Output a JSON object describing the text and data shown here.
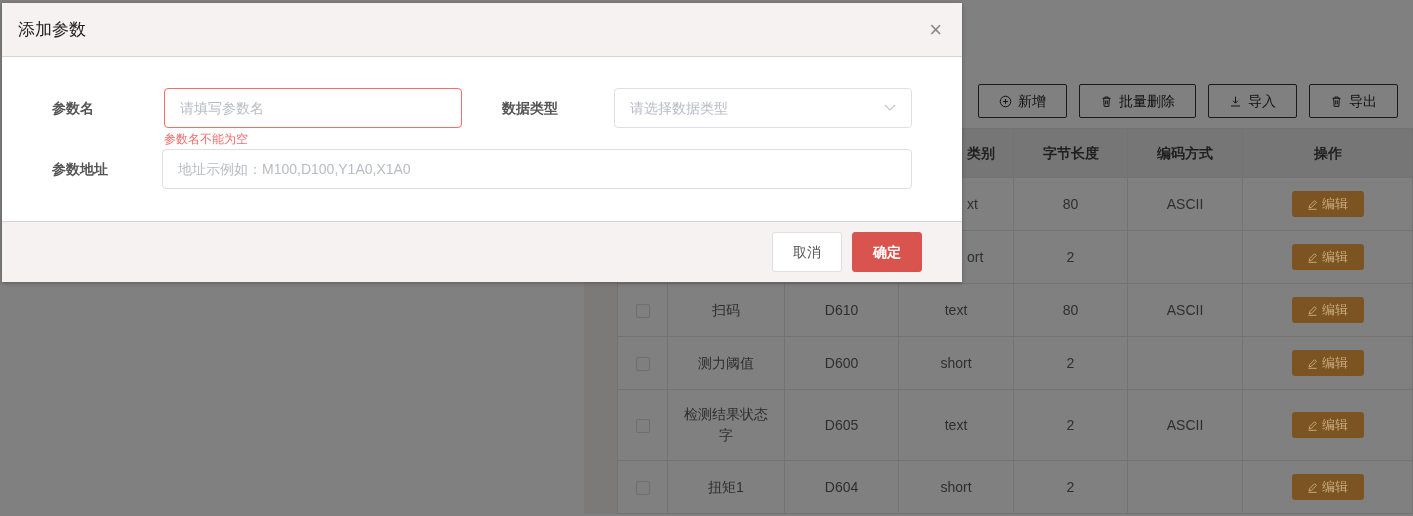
{
  "dialog": {
    "title": "添加参数",
    "close": "×",
    "fields": [
      {
        "kind": "text",
        "label": "参数名",
        "placeholder": "请填写参数名",
        "error": "参数名不能为空"
      },
      {
        "kind": "select",
        "label": "数据类型",
        "placeholder": "请选择数据类型"
      },
      {
        "kind": "text",
        "label": "参数地址",
        "placeholder": "地址示例如：M100,D100,Y1A0,X1A0"
      }
    ],
    "buttons": [
      {
        "kind": "secondary",
        "label": "取消"
      },
      {
        "kind": "primary",
        "label": "确定"
      }
    ]
  },
  "toolbar": [
    {
      "kind": "add",
      "label": "新增"
    },
    {
      "kind": "delete",
      "label": "批量删除"
    },
    {
      "kind": "import",
      "label": "导入"
    },
    {
      "kind": "export",
      "label": "导出"
    }
  ],
  "table": {
    "columns": [
      "类别",
      "字节长度",
      "编码方式",
      "操作"
    ],
    "rows": [
      {
        "type": "xt",
        "length": "80",
        "encoding": "ASCII",
        "action": "编辑"
      },
      {
        "type": "ort",
        "length": "2",
        "action": "编辑"
      },
      {
        "checked": false,
        "name": "扫码",
        "address": "D610",
        "type": "text",
        "length": "80",
        "encoding": "ASCII",
        "action": "编辑"
      },
      {
        "checked": false,
        "name": "测力阈值",
        "address": "D600",
        "type": "short",
        "length": "2",
        "action": "编辑"
      },
      {
        "checked": false,
        "name": "检测结果状态字",
        "address": "D605",
        "type": "text",
        "length": "2",
        "encoding": "ASCII",
        "action": "编辑"
      },
      {
        "checked": false,
        "name": "扭矩1",
        "address": "D604",
        "type": "short",
        "length": "2",
        "action": "编辑"
      }
    ]
  }
}
